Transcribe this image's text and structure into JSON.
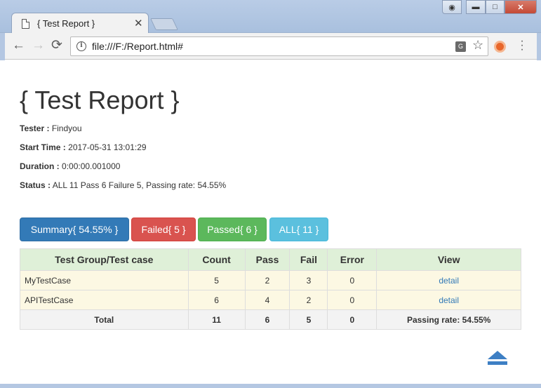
{
  "browser": {
    "tab_title": "{ Test Report }",
    "tab_close": "✕",
    "url": "file:///F:/Report.html#",
    "nav_back": "←",
    "nav_forward": "→",
    "nav_reload": "⟳",
    "win_min": "▬",
    "win_max": "□",
    "win_close": "✕"
  },
  "report": {
    "title": "{ Test Report }",
    "tester_label": "Tester :",
    "tester": "Findyou",
    "start_label": "Start Time :",
    "start_time": "2017-05-31 13:01:29",
    "duration_label": "Duration :",
    "duration": "0:00:00.001000",
    "status_label": "Status :",
    "status": "ALL 11 Pass 6 Failure 5, Passing rate: 54.55%"
  },
  "filters": {
    "summary": "Summary{ 54.55% }",
    "failed": "Failed{ 5 }",
    "passed": "Passed{ 6 }",
    "all": "ALL{ 11 }"
  },
  "table": {
    "headers": [
      "Test Group/Test case",
      "Count",
      "Pass",
      "Fail",
      "Error",
      "View"
    ],
    "rows": [
      {
        "name": "MyTestCase",
        "count": "5",
        "pass": "2",
        "fail": "3",
        "error": "0",
        "view": "detail"
      },
      {
        "name": "APITestCase",
        "count": "6",
        "pass": "4",
        "fail": "2",
        "error": "0",
        "view": "detail"
      }
    ],
    "total": {
      "name": "Total",
      "count": "11",
      "pass": "6",
      "fail": "5",
      "error": "0",
      "view": "Passing rate: 54.55%"
    }
  },
  "colors": {
    "primary": "#337ab7",
    "danger": "#d9534f",
    "success": "#5cb85c",
    "info": "#5bc0de",
    "header_bg": "#dff0d8",
    "row_bg": "#fcf8e3"
  },
  "icons": {
    "tab_page": "page-icon",
    "info": "info-icon",
    "translate": "translate-icon",
    "bookmark": "star-icon",
    "extension": "extension-icon",
    "menu": "more-vert-icon",
    "scroll_top": "arrow-to-top-icon"
  }
}
